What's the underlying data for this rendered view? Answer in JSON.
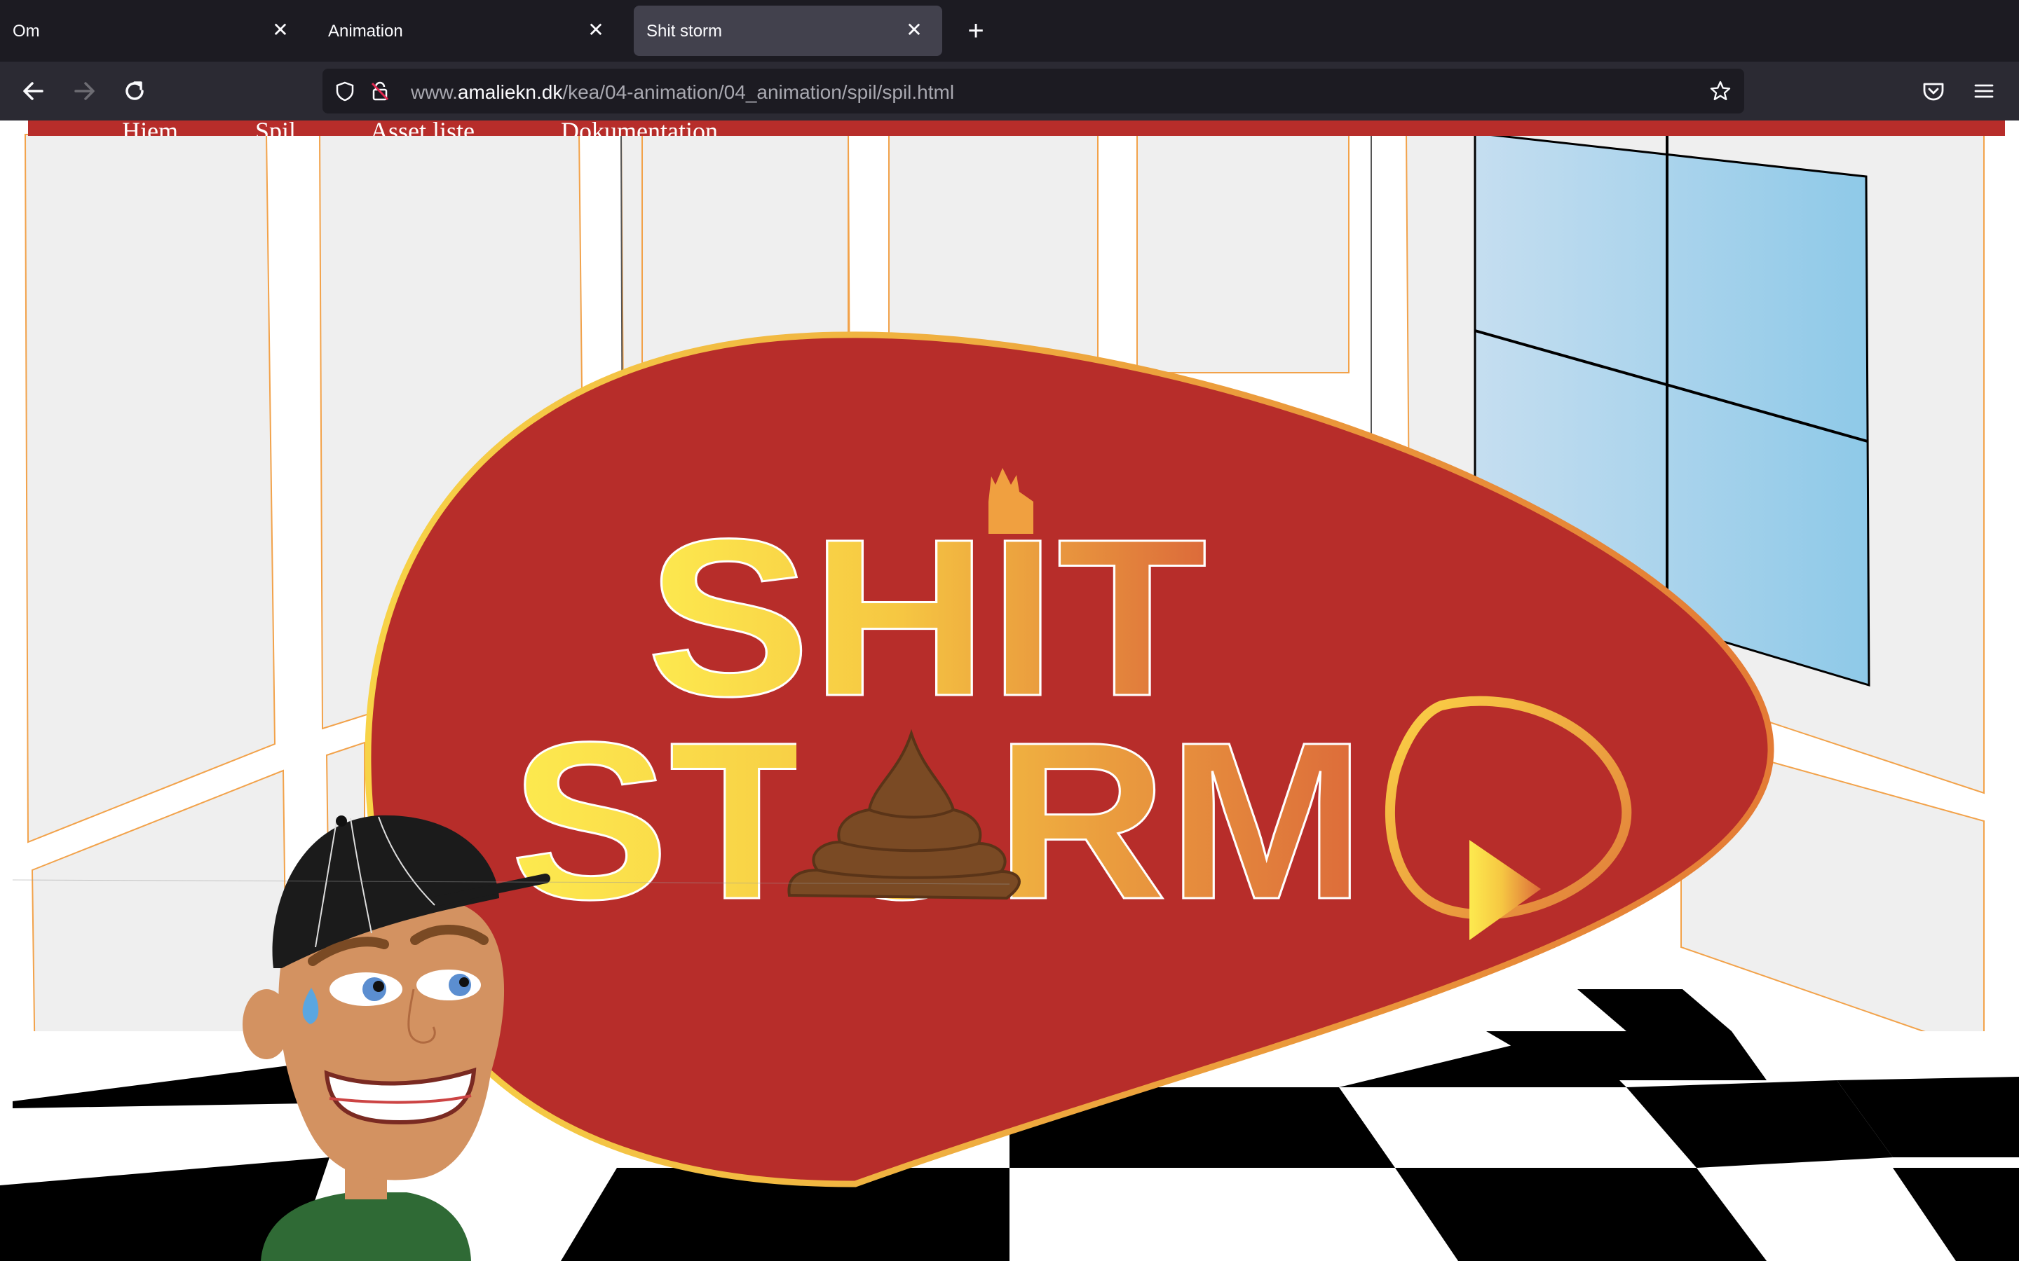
{
  "browser": {
    "tabs": [
      {
        "label": "Om",
        "active": false
      },
      {
        "label": "Animation",
        "active": false
      },
      {
        "label": "Shit storm",
        "active": true
      }
    ],
    "url": {
      "prefix": "www.",
      "domain": "amaliekn.dk",
      "path": "/kea/04-animation/04_animation/spil/spil.html"
    }
  },
  "site_nav": {
    "items": [
      "Hjem",
      "Spil",
      "Asset liste",
      "Dokumentation"
    ]
  },
  "game": {
    "title_line1": "SHIT",
    "title_line2": "STORM",
    "play_icon": "play-icon",
    "colors": {
      "blob": "#b72d2a",
      "title_gradient_start": "#fdea4f",
      "title_gradient_end": "#dc6a3a",
      "floor_dark": "#000000",
      "window": "#8ec9e8"
    }
  }
}
